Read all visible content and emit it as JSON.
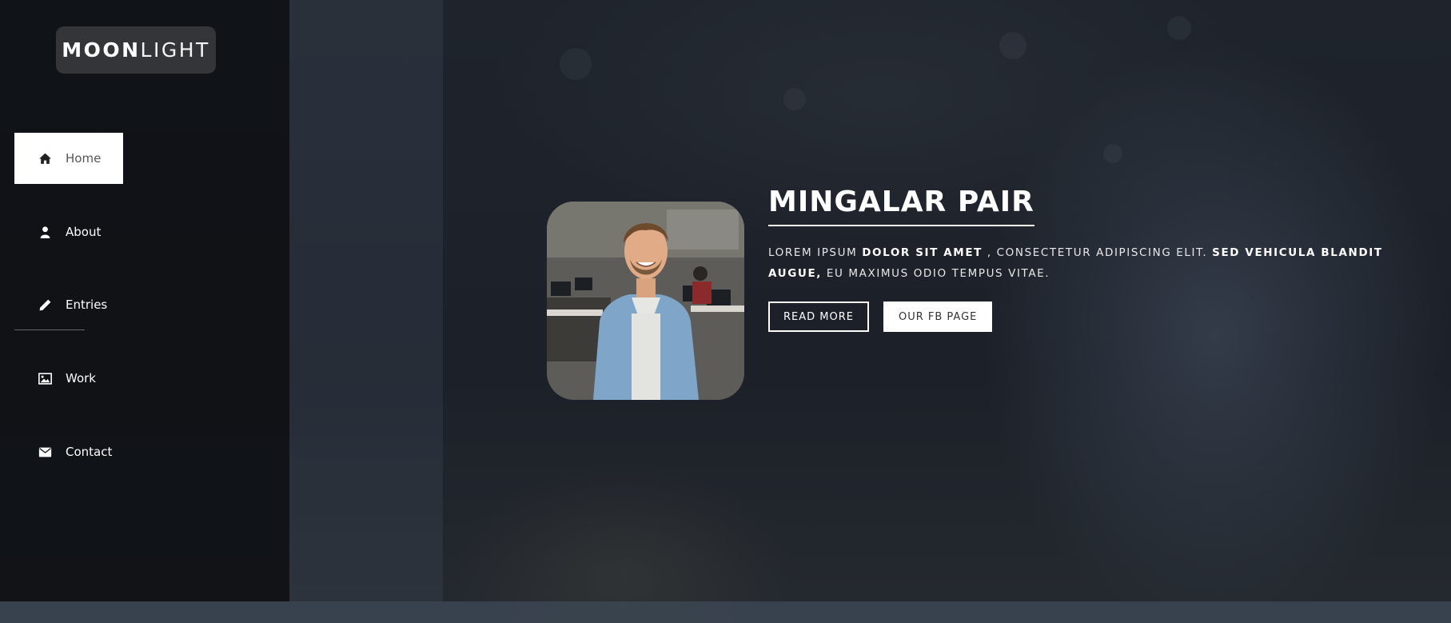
{
  "brand": {
    "bold": "MOON",
    "light": "LIGHT"
  },
  "nav": {
    "items": [
      {
        "label": "Home",
        "icon": "home-icon",
        "active": true
      },
      {
        "label": "About",
        "icon": "user-icon",
        "active": false
      },
      {
        "label": "Entries",
        "icon": "pencil-icon",
        "active": false
      },
      {
        "label": "Work",
        "icon": "image-icon",
        "active": false
      },
      {
        "label": "Contact",
        "icon": "envelope-icon",
        "active": false
      }
    ]
  },
  "hero": {
    "title": "MINGALAR PAIR",
    "desc": {
      "p1": "LOREM IPSUM ",
      "b1": "DOLOR SIT AMET",
      "p2": " , CONSECTETUR ADIPISCING ELIT. ",
      "b2": "SED VEHICULA BLANDIT AUGUE,",
      "p3": " EU MAXIMUS ODIO TEMPUS VITAE."
    },
    "read_more": "READ MORE",
    "fb_page": "OUR FB PAGE",
    "profile_image": "man-smiling-in-office-photo"
  },
  "colors": {
    "sidebar_bg": "#0e1014",
    "active_nav_bg": "#ffffff",
    "text": "#ffffff"
  }
}
